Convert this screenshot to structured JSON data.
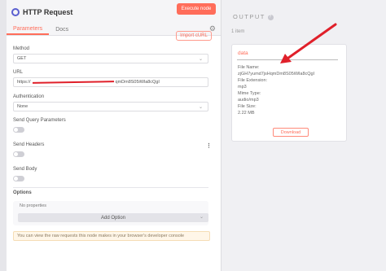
{
  "node": {
    "title": "HTTP Request",
    "execute_label": "Execute node"
  },
  "tabs": [
    {
      "label": "Parameters"
    },
    {
      "label": "Docs"
    }
  ],
  "params": {
    "import_label": "Import cURL",
    "method_label": "Method",
    "method_value": "GET",
    "url_label": "URL",
    "url_prefix": "https://",
    "url_suffix": "qmDm8S05iWla8cQgI",
    "auth_label": "Authentication",
    "auth_value": "None",
    "send_query_label": "Send Query Parameters",
    "send_headers_label": "Send Headers",
    "send_body_label": "Send Body",
    "options_label": "Options",
    "no_properties": "No properties",
    "add_option_label": "Add Option",
    "info_text": "You can view the raw requests this node makes in your browser's developer console"
  },
  "output": {
    "title": "OUTPUT",
    "item_count": "1 item",
    "card_title": "data",
    "file_name_label": "File Name:",
    "file_name_value": "zjGH7yumd7jsHqmDm8S05iWla8cQgI",
    "file_ext_label": "File Extension:",
    "file_ext_value": "mp3",
    "mime_label": "Mime Type:",
    "mime_value": "audio/mp3",
    "size_label": "File Size:",
    "size_value": "2.22 MB",
    "download_label": "Download"
  },
  "colors": {
    "accent": "#ff6d5a",
    "redaction": "#e0202a",
    "arrow": "#e0202a"
  }
}
